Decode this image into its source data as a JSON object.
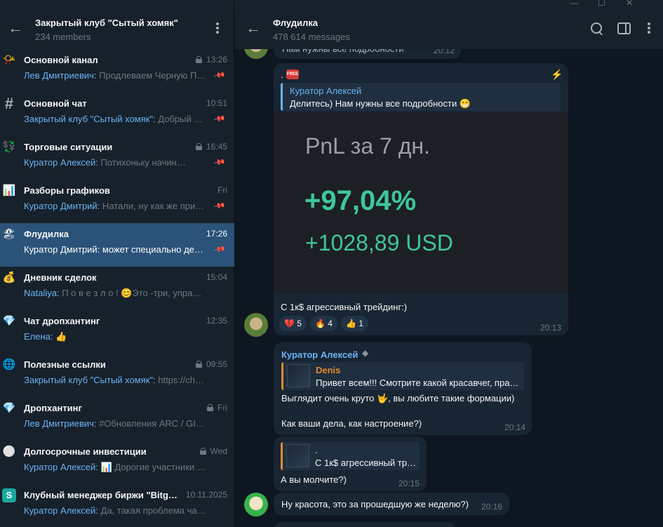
{
  "left_panel": {
    "title": "Закрытый клуб \"Сытый хомяк\"",
    "subtitle": "234 members",
    "topics": [
      {
        "icon": "📯",
        "name": "Основной канал",
        "time": "13:26",
        "locked": true,
        "sender": "Лев Дмитриевич:",
        "preview": " Продлеваем Черную П…"
      },
      {
        "icon": "#",
        "name": "Основной чат",
        "time": "10:51",
        "locked": false,
        "sender": "Закрытый клуб \"Сытый хомяк\":",
        "preview": " Добрый …"
      },
      {
        "icon": "💱",
        "name": "Торговые ситуации",
        "time": "16:45",
        "locked": true,
        "sender": "Куратор Алексей:",
        "preview": " Потихоньку начин…"
      },
      {
        "icon": "📊",
        "name": "Разборы графиков",
        "time": "Fri",
        "locked": false,
        "sender": "Куратор Дмитрий:",
        "preview": " Натали, ну как же при…"
      },
      {
        "icon": "🏖",
        "name": "Флудилка",
        "time": "17:26",
        "locked": false,
        "sender": "Куратор Дмитрий:",
        "preview": " может специально де…"
      },
      {
        "icon": "💰",
        "name": "Дневник сделок",
        "time": "15:04",
        "locked": false,
        "sender": "Nataliya:",
        "preview": " П о в е з л о ! 😊Это -три, упраж…"
      },
      {
        "icon": "💎",
        "name": "Чат дропхантинг",
        "time": "12:35",
        "locked": false,
        "sender": "Елена:",
        "preview": " 👍"
      },
      {
        "icon": "🌐",
        "name": "Полезные ссылки",
        "time": "09:55",
        "locked": true,
        "sender": "Закрытый клуб \"Сытый хомяк\":",
        "preview": " https://ch…"
      },
      {
        "icon": "💎",
        "name": "Дропхантинг",
        "time": "Fri",
        "locked": true,
        "sender": "Лев Дмитриевич:",
        "preview": " #Обновления ARC / GI…"
      },
      {
        "icon": "⚪",
        "name": "Долгосрочные инвестиции",
        "time": "Wed",
        "locked": true,
        "sender": "Куратор Алексей:",
        "preview": " 📊 Дорогие участники клу…"
      },
      {
        "icon": "S",
        "name": "Клубный менеджер биржи \"Bitg…",
        "time": "10.11.2025",
        "locked": false,
        "sender": "Куратор Алексей:",
        "preview": " Да, такая проблема часта с…"
      }
    ]
  },
  "chat": {
    "title": "Флудилка",
    "subtitle": "478 614 messages",
    "top_time": "20:12",
    "top_partial": "Нам нужны все подробности",
    "pnl_message": {
      "free_label": "FREE",
      "reply_name": "Куратор Алексей",
      "reply_text": "Делитесь)  Нам нужны все подробности 😁",
      "pnl_title": "PnL за 7 дн.",
      "pnl_percent": "+97,04%",
      "pnl_usd": "+1028,89 USD",
      "caption": "С 1к$ агрессивный трейдинг:)",
      "reactions": [
        {
          "emoji": "💔",
          "count": "5"
        },
        {
          "emoji": "🔥",
          "count": "4"
        },
        {
          "emoji": "👍",
          "count": "1"
        }
      ],
      "time": "20:13"
    },
    "msg2": {
      "author": "Куратор Алексей",
      "reply_name": "Denis",
      "reply_text": "Привет всем!!! Смотрите какой красавчег, пра…",
      "line1": "Выглядит очень круто 🤟, вы любите такие формации)",
      "line2": "Как ваши дела, как настроение?)",
      "time": "20:14"
    },
    "msg3": {
      "reply_name": ".",
      "reply_text": "С 1к$ агрессивный тр…",
      "text": "А вы молчите?)",
      "time": "20:15"
    },
    "msg4": {
      "text": "Ну красота, это за прошедшую же неделю?)",
      "time": "20:16"
    }
  }
}
